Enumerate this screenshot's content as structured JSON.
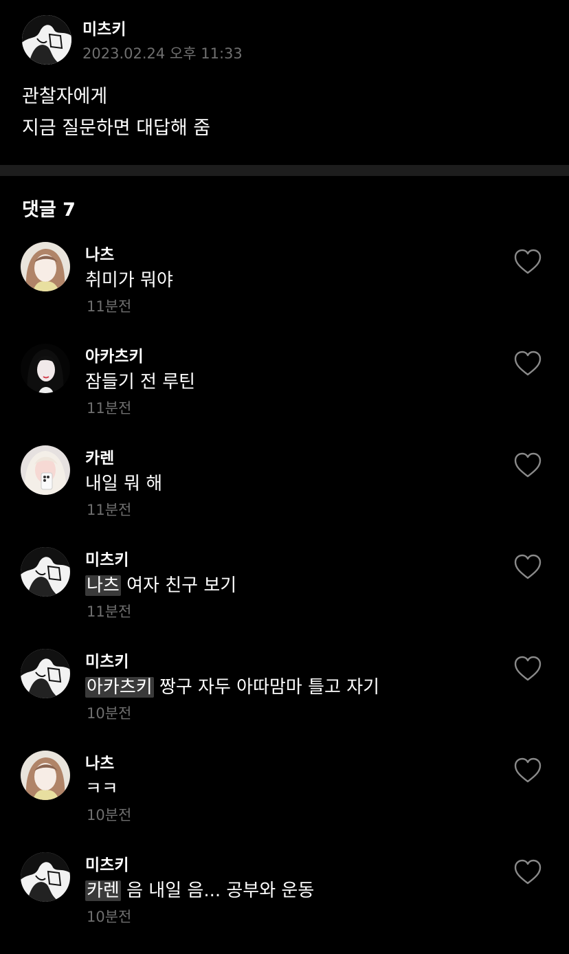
{
  "post": {
    "author": "미츠키",
    "timestamp": "2023.02.24 오후 11:33",
    "body_line1": "관찰자에게",
    "body_line2": "지금 질문하면 대답해 줌"
  },
  "comments_header": "댓글 7",
  "comments": [
    {
      "name": "나츠",
      "mention": "",
      "text": "취미가 뭐야",
      "time": "11분전",
      "avatar": "nachu"
    },
    {
      "name": "아카츠키",
      "mention": "",
      "text": "잠들기 전 루틴",
      "time": "11분전",
      "avatar": "akatsuki"
    },
    {
      "name": "카렌",
      "mention": "",
      "text": "내일 뭐 해",
      "time": "11분전",
      "avatar": "karen"
    },
    {
      "name": "미츠키",
      "mention": "나츠",
      "text": " 여자 친구 보기",
      "time": "11분전",
      "avatar": "mitsuki"
    },
    {
      "name": "미츠키",
      "mention": "아카츠키",
      "text": " 짱구 자두 아따맘마 틀고 자기",
      "time": "10분전",
      "avatar": "mitsuki"
    },
    {
      "name": "나츠",
      "mention": "",
      "text": "ㅋㅋ",
      "time": "10분전",
      "avatar": "nachu"
    },
    {
      "name": "미츠키",
      "mention": "카렌",
      "text": " 음 내일 음... 공부와 운동",
      "time": "10분전",
      "avatar": "mitsuki"
    }
  ],
  "icons": {
    "like": "heart-outline-icon"
  },
  "colors": {
    "background": "#000000",
    "secondary_text": "#6f6f6f",
    "divider": "#1d1d1d",
    "mention_bg": "#3a3a3a"
  }
}
